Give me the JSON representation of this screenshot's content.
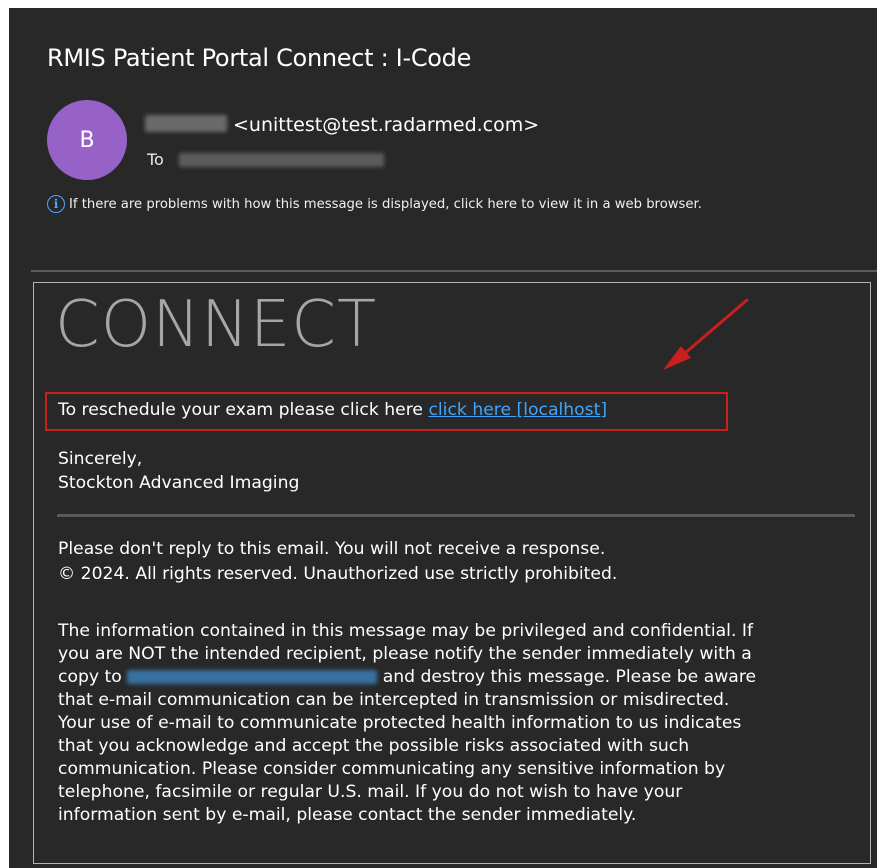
{
  "email": {
    "subject": "RMIS Patient Portal Connect : I-Code",
    "avatar_letter": "B",
    "sender_email": "<unittest@test.radarmed.com>",
    "to_label": "To",
    "info_text": "If there are problems with how this message is displayed, click here to view it in a web browser."
  },
  "body": {
    "logo_text": "CONNECT",
    "reschedule_text": "To reschedule your exam please click here ",
    "reschedule_link": "click here [localhost]",
    "sincerely": "Sincerely,",
    "organization": "Stockton Advanced Imaging",
    "no_reply": "Please don't reply to this email. You will not receive a response.",
    "copyright": "© 2024. All rights reserved. Unauthorized use strictly prohibited.",
    "disclaimer": {
      "line1": "The information contained in this message may be privileged and confidential. If",
      "line2": "you are NOT the intended recipient, please notify the sender immediately with a",
      "line3_prefix": "copy to ",
      "line3_suffix": " and destroy this message. Please be aware",
      "line4": "that e-mail communication can be intercepted in transmission or misdirected.",
      "line5": "Your use of e-mail to communicate protected health information to us indicates",
      "line6": "that you acknowledge and accept the possible risks associated with such",
      "line7": "communication. Please consider communicating any sensitive information by",
      "line8": "telephone, facsimile or regular U.S. mail. If you do not wish to have your",
      "line9": "information sent by e-mail, please contact the sender immediately."
    }
  },
  "colors": {
    "background": "#282828",
    "avatar": "#9762c8",
    "link": "#3ea6ff",
    "annotation_red": "#c81f1f"
  },
  "icons": [
    "info-icon",
    "red-arrow-annotation"
  ]
}
